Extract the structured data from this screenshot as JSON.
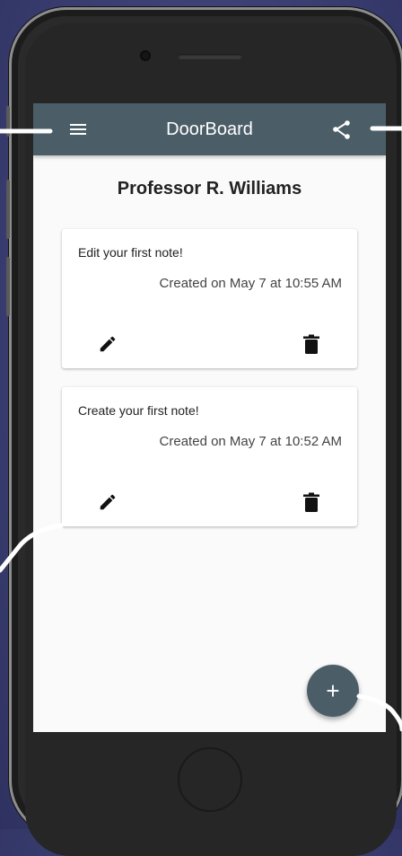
{
  "appbar": {
    "title": "DoorBoard",
    "menu_icon": "menu-icon",
    "share_icon": "share-icon",
    "color": "#4b5e68"
  },
  "professor_name": "Professor R. Williams",
  "notes": [
    {
      "text": "Edit your first note!",
      "created": "Created on May 7 at 10:55 AM",
      "edit_icon": "pencil-icon",
      "delete_icon": "trash-icon"
    },
    {
      "text": "Create your first note!",
      "created": "Created on May 7 at 10:52 AM",
      "edit_icon": "pencil-icon",
      "delete_icon": "trash-icon"
    }
  ],
  "fab": {
    "label": "+",
    "icon": "add-icon"
  }
}
